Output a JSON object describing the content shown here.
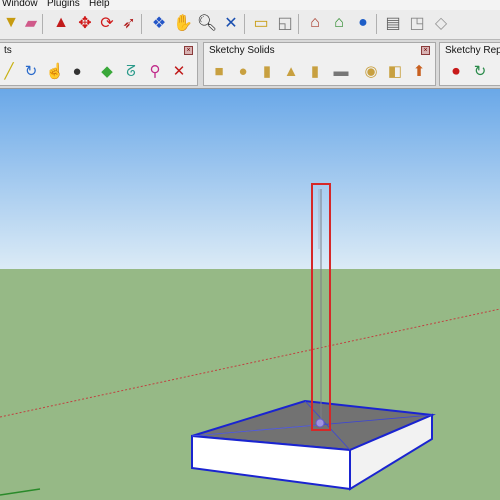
{
  "menu": {
    "items": [
      "Window",
      "Plugins",
      "Help"
    ]
  },
  "toolbar_main": {
    "icons": [
      "paint-bucket-icon",
      "eraser-icon",
      "push-pull-icon",
      "move-icon",
      "rotate-icon",
      "follow-me-icon",
      "orbit-icon",
      "pan-icon",
      "zoom-icon",
      "zoom-extents-icon",
      "position-camera-icon",
      "walk-icon",
      "warehouse-get-icon",
      "warehouse-share-icon",
      "google-earth-icon",
      "section-plane-icon",
      "component-icon"
    ]
  },
  "panels": [
    {
      "title": "ts",
      "icons": [
        "tape-measure-icon",
        "refresh-icon",
        "hand-icon",
        "ball-icon",
        "paint-icon",
        "curve-icon",
        "wand-icon",
        "close-red-icon"
      ]
    },
    {
      "title": "Sketchy Solids",
      "icons": [
        "cube-solid-icon",
        "sphere-solid-icon",
        "cylinder-solid-icon",
        "cone-solid-icon",
        "tube-solid-icon",
        "plate-solid-icon",
        "torus-solid-icon",
        "box-solid-icon",
        "extra-solid-icon"
      ]
    },
    {
      "title": "Sketchy Repla",
      "icons": [
        "record-icon",
        "replay-icon"
      ]
    }
  ],
  "colors": {
    "sky_top": "#6aa8e8",
    "sky_bottom": "#dcebf6",
    "ground": "#96b986",
    "selection": "#d62828",
    "edge_blue": "#1a24d0",
    "top_face": "#6e6e6e"
  }
}
